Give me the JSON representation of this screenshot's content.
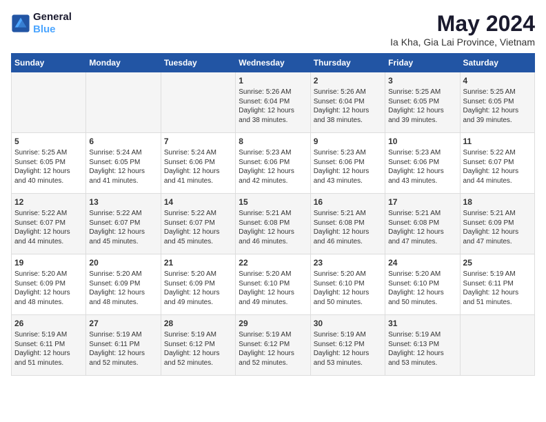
{
  "header": {
    "logo_line1": "General",
    "logo_line2": "Blue",
    "title": "May 2024",
    "subtitle": "Ia Kha, Gia Lai Province, Vietnam"
  },
  "days_of_week": [
    "Sunday",
    "Monday",
    "Tuesday",
    "Wednesday",
    "Thursday",
    "Friday",
    "Saturday"
  ],
  "weeks": [
    [
      {
        "day": "",
        "info": ""
      },
      {
        "day": "",
        "info": ""
      },
      {
        "day": "",
        "info": ""
      },
      {
        "day": "1",
        "info": "Sunrise: 5:26 AM\nSunset: 6:04 PM\nDaylight: 12 hours\nand 38 minutes."
      },
      {
        "day": "2",
        "info": "Sunrise: 5:26 AM\nSunset: 6:04 PM\nDaylight: 12 hours\nand 38 minutes."
      },
      {
        "day": "3",
        "info": "Sunrise: 5:25 AM\nSunset: 6:05 PM\nDaylight: 12 hours\nand 39 minutes."
      },
      {
        "day": "4",
        "info": "Sunrise: 5:25 AM\nSunset: 6:05 PM\nDaylight: 12 hours\nand 39 minutes."
      }
    ],
    [
      {
        "day": "5",
        "info": "Sunrise: 5:25 AM\nSunset: 6:05 PM\nDaylight: 12 hours\nand 40 minutes."
      },
      {
        "day": "6",
        "info": "Sunrise: 5:24 AM\nSunset: 6:05 PM\nDaylight: 12 hours\nand 41 minutes."
      },
      {
        "day": "7",
        "info": "Sunrise: 5:24 AM\nSunset: 6:06 PM\nDaylight: 12 hours\nand 41 minutes."
      },
      {
        "day": "8",
        "info": "Sunrise: 5:23 AM\nSunset: 6:06 PM\nDaylight: 12 hours\nand 42 minutes."
      },
      {
        "day": "9",
        "info": "Sunrise: 5:23 AM\nSunset: 6:06 PM\nDaylight: 12 hours\nand 43 minutes."
      },
      {
        "day": "10",
        "info": "Sunrise: 5:23 AM\nSunset: 6:06 PM\nDaylight: 12 hours\nand 43 minutes."
      },
      {
        "day": "11",
        "info": "Sunrise: 5:22 AM\nSunset: 6:07 PM\nDaylight: 12 hours\nand 44 minutes."
      }
    ],
    [
      {
        "day": "12",
        "info": "Sunrise: 5:22 AM\nSunset: 6:07 PM\nDaylight: 12 hours\nand 44 minutes."
      },
      {
        "day": "13",
        "info": "Sunrise: 5:22 AM\nSunset: 6:07 PM\nDaylight: 12 hours\nand 45 minutes."
      },
      {
        "day": "14",
        "info": "Sunrise: 5:22 AM\nSunset: 6:07 PM\nDaylight: 12 hours\nand 45 minutes."
      },
      {
        "day": "15",
        "info": "Sunrise: 5:21 AM\nSunset: 6:08 PM\nDaylight: 12 hours\nand 46 minutes."
      },
      {
        "day": "16",
        "info": "Sunrise: 5:21 AM\nSunset: 6:08 PM\nDaylight: 12 hours\nand 46 minutes."
      },
      {
        "day": "17",
        "info": "Sunrise: 5:21 AM\nSunset: 6:08 PM\nDaylight: 12 hours\nand 47 minutes."
      },
      {
        "day": "18",
        "info": "Sunrise: 5:21 AM\nSunset: 6:09 PM\nDaylight: 12 hours\nand 47 minutes."
      }
    ],
    [
      {
        "day": "19",
        "info": "Sunrise: 5:20 AM\nSunset: 6:09 PM\nDaylight: 12 hours\nand 48 minutes."
      },
      {
        "day": "20",
        "info": "Sunrise: 5:20 AM\nSunset: 6:09 PM\nDaylight: 12 hours\nand 48 minutes."
      },
      {
        "day": "21",
        "info": "Sunrise: 5:20 AM\nSunset: 6:09 PM\nDaylight: 12 hours\nand 49 minutes."
      },
      {
        "day": "22",
        "info": "Sunrise: 5:20 AM\nSunset: 6:10 PM\nDaylight: 12 hours\nand 49 minutes."
      },
      {
        "day": "23",
        "info": "Sunrise: 5:20 AM\nSunset: 6:10 PM\nDaylight: 12 hours\nand 50 minutes."
      },
      {
        "day": "24",
        "info": "Sunrise: 5:20 AM\nSunset: 6:10 PM\nDaylight: 12 hours\nand 50 minutes."
      },
      {
        "day": "25",
        "info": "Sunrise: 5:19 AM\nSunset: 6:11 PM\nDaylight: 12 hours\nand 51 minutes."
      }
    ],
    [
      {
        "day": "26",
        "info": "Sunrise: 5:19 AM\nSunset: 6:11 PM\nDaylight: 12 hours\nand 51 minutes."
      },
      {
        "day": "27",
        "info": "Sunrise: 5:19 AM\nSunset: 6:11 PM\nDaylight: 12 hours\nand 52 minutes."
      },
      {
        "day": "28",
        "info": "Sunrise: 5:19 AM\nSunset: 6:12 PM\nDaylight: 12 hours\nand 52 minutes."
      },
      {
        "day": "29",
        "info": "Sunrise: 5:19 AM\nSunset: 6:12 PM\nDaylight: 12 hours\nand 52 minutes."
      },
      {
        "day": "30",
        "info": "Sunrise: 5:19 AM\nSunset: 6:12 PM\nDaylight: 12 hours\nand 53 minutes."
      },
      {
        "day": "31",
        "info": "Sunrise: 5:19 AM\nSunset: 6:13 PM\nDaylight: 12 hours\nand 53 minutes."
      },
      {
        "day": "",
        "info": ""
      }
    ]
  ]
}
